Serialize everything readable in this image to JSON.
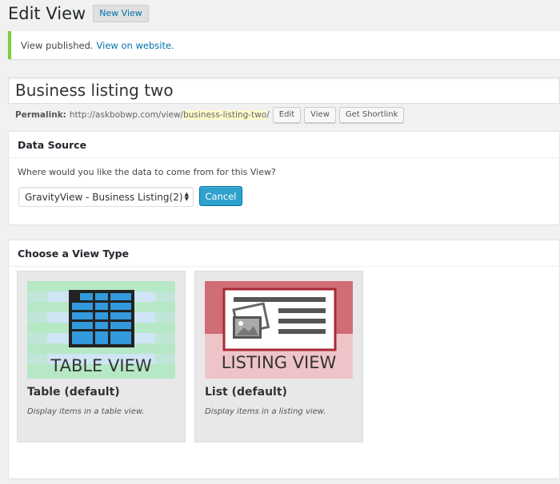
{
  "header": {
    "title": "Edit View",
    "new_button": "New View"
  },
  "notice": {
    "message": "View published.",
    "link": "View on website."
  },
  "post": {
    "title": "Business listing two"
  },
  "permalink": {
    "label": "Permalink:",
    "base": "http://askbobwp.com/view/",
    "slug": "business-listing-two",
    "trailing": "/",
    "buttons": {
      "edit": "Edit",
      "view": "View",
      "shortlink": "Get Shortlink"
    }
  },
  "data_source": {
    "heading": "Data Source",
    "question": "Where would you like the data to come from for this View?",
    "selected_form": "GravityView - Business Listing(2)",
    "cancel_label": "Cancel"
  },
  "view_type": {
    "heading": "Choose a View Type",
    "options": [
      {
        "name": "Table (default)",
        "description": "Display items in a table view.",
        "image_caption": "TABLE VIEW",
        "icon": "table-grid-icon"
      },
      {
        "name": "List (default)",
        "description": "Display items in a listing view.",
        "image_caption": "LISTING VIEW",
        "icon": "listing-card-icon"
      }
    ]
  },
  "colors": {
    "accent_blue": "#2ea2cc",
    "link": "#0073aa",
    "notice_green": "#7ad03a",
    "table_green": "#b6e8c5",
    "table_blue": "#cfe4f5",
    "table_cells": "#3399dd",
    "listing_dark": "#d06d77",
    "listing_light": "#efc4c8",
    "listing_frame": "#a92a35"
  }
}
